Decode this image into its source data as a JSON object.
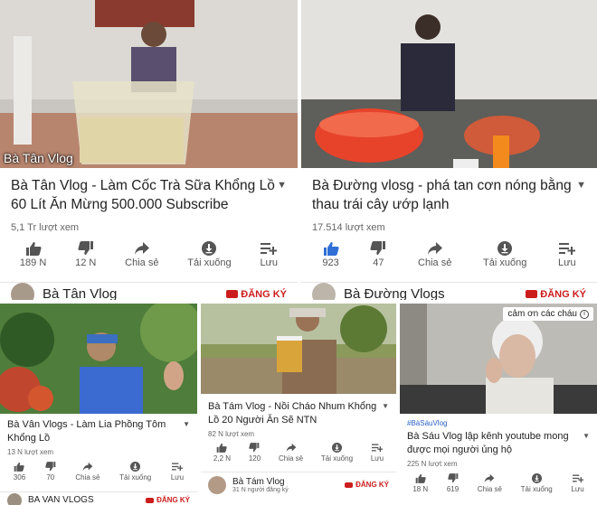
{
  "videos": [
    {
      "thumb_label": "Bà Tân Vlog",
      "title": "Bà Tân Vlog - Làm Cốc Trà Sữa Khổng Lồ 60 Lít Ăn Mừng 500.000 Subscribe",
      "views": "5,1 Tr lượt xem",
      "actions": {
        "like": "189 N",
        "dislike": "12 N",
        "share": "Chia sẻ",
        "download": "Tải xuống",
        "save": "Lưu"
      },
      "channel": "Bà Tân Vlog",
      "subscribe": "ĐĂNG KÝ",
      "liked": false
    },
    {
      "title": "Bà Đường vlosg - phá tan cơn nóng bằng thau trái cây ướp lạnh",
      "views": "17.514 lượt xem",
      "actions": {
        "like": "923",
        "dislike": "47",
        "share": "Chia sẻ",
        "download": "Tải xuống",
        "save": "Lưu"
      },
      "channel": "Bà Đường Vlogs",
      "subscribe": "ĐĂNG KÝ",
      "liked": true
    },
    {
      "title": "Bà Vân Vlogs - Làm Lia Phồng Tôm Khổng Lồ",
      "views": "13 N lượt xem",
      "actions": {
        "like": "306",
        "dislike": "70",
        "share": "Chia sẻ",
        "download": "Tải xuống",
        "save": "Lưu"
      },
      "channel": "BA VAN VLOGS",
      "subscribe": "ĐĂNG KÝ"
    },
    {
      "title": "Bà Tám Vlog - Nồi Cháo Nhum Khổng Lồ 20 Người Ăn Sẽ NTN",
      "views": "82 N lượt xem",
      "actions": {
        "like": "2,2 N",
        "dislike": "120",
        "share": "Chia sẻ",
        "download": "Tải xuống",
        "save": "Lưu"
      },
      "channel": "Bà Tám Vlog",
      "subscribers": "31 N người đăng ký",
      "subscribe": "ĐĂNG KÝ"
    },
    {
      "tooltip": "cảm ơn các cháu",
      "hashtag": "#BàSáuVlog",
      "title": "Bà Sáu Vlog lập kênh youtube mong được mọi người ủng hộ",
      "views": "225 N lượt xem",
      "actions": {
        "like": "18 N",
        "dislike": "619",
        "share": "Chia sẻ",
        "download": "Tải xuống",
        "save": "Lưu"
      }
    }
  ],
  "colors": {
    "accent": "#cc1d1d",
    "liked": "#2f6fd6",
    "icon": "#555555"
  },
  "icons": {
    "like": "thumbs-up-icon",
    "dislike": "thumbs-down-icon",
    "share": "share-arrow-icon",
    "download": "download-circle-icon",
    "save": "add-to-playlist-icon",
    "menu": "kebab-menu-icon",
    "subscribe": "youtube-play-icon",
    "info": "info-icon"
  }
}
